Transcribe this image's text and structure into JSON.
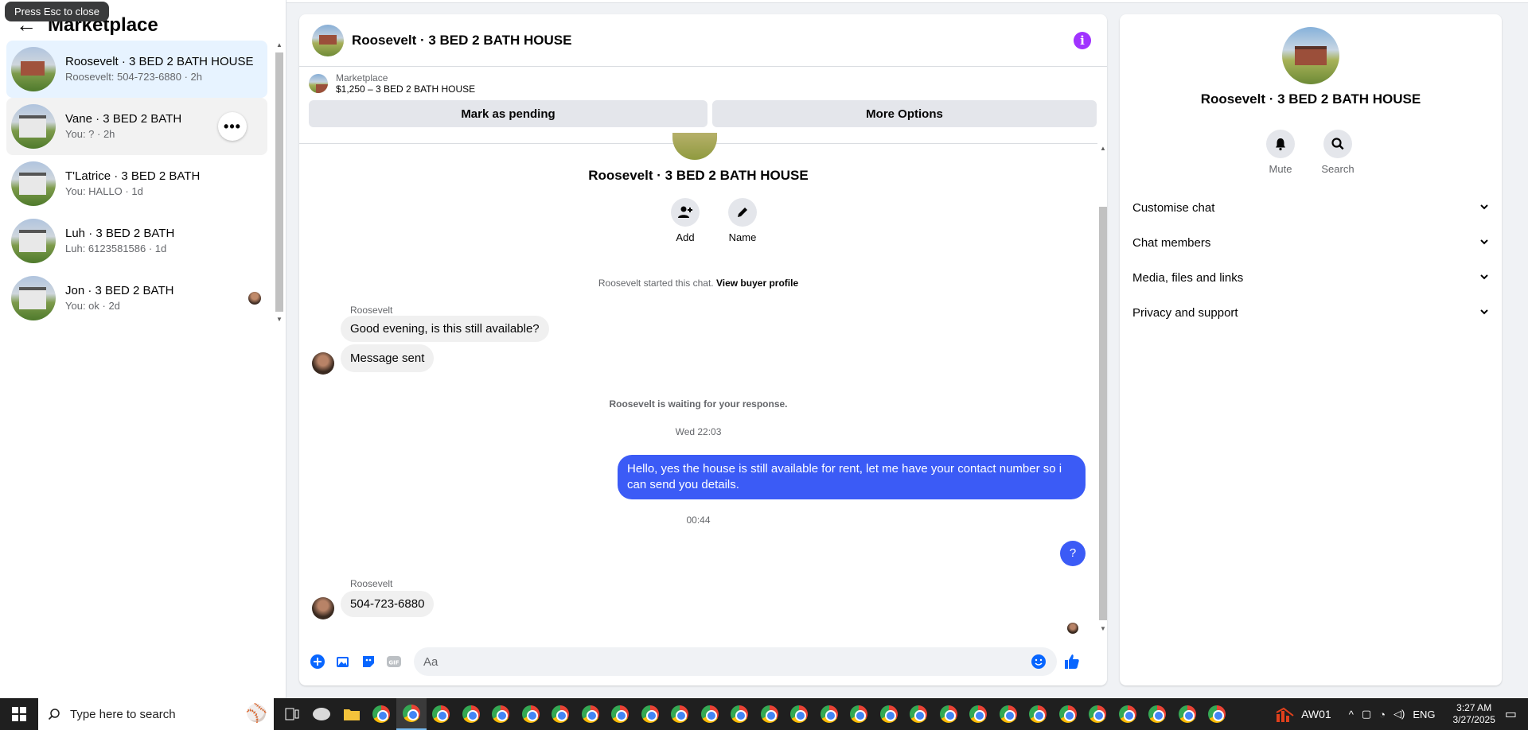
{
  "tooltip": "Press Esc to close",
  "left_panel": {
    "title": "Marketplace",
    "conversations": [
      {
        "title": "Roosevelt · 3 BED 2 BATH HOUSE",
        "subtitle": "Roosevelt: 504-723-6880 · 2h",
        "state": "selected"
      },
      {
        "title": "Vane · 3 BED 2 BATH",
        "subtitle": "You: ? · 2h",
        "state": "hover"
      },
      {
        "title": "T'Latrice · 3 BED 2 BATH",
        "subtitle": "You: HALLO · 1d",
        "state": ""
      },
      {
        "title": "Luh · 3 BED 2 BATH",
        "subtitle": "Luh: 6123581586 · 1d",
        "state": ""
      },
      {
        "title": "Jon · 3 BED 2 BATH",
        "subtitle": "You: ok · 2d",
        "state": ""
      }
    ],
    "more_label": "•••"
  },
  "chat": {
    "header_name": "Roosevelt · 3 BED 2 BATH HOUSE",
    "info_icon": "i",
    "listing_label": "Marketplace",
    "listing_price": "$1,250 – 3 BED 2 BATH HOUSE",
    "mark_pending": "Mark as pending",
    "more_options": "More Options",
    "conv_name": "Roosevelt · 3 BED 2 BATH HOUSE",
    "add_label": "Add",
    "name_label": "Name",
    "started_text": "Roosevelt started this chat.",
    "view_profile": "View buyer profile",
    "sender1": "Roosevelt",
    "msg1": "Good evening, is this still available?",
    "msg2": "Message sent",
    "waiting": "Roosevelt is waiting for your response.",
    "time1": "Wed 22:03",
    "msg3": "Hello, yes the house is still available for rent, let me have your contact number so i can send you details.",
    "time2": "00:44",
    "msg4": "?",
    "sender2": "Roosevelt",
    "msg5": "504-723-6880",
    "composer_placeholder": "Aa"
  },
  "right_panel": {
    "name": "Roosevelt · 3 BED 2 BATH HOUSE",
    "mute": "Mute",
    "search": "Search",
    "sections": [
      "Customise chat",
      "Chat members",
      "Media, files and links",
      "Privacy and support"
    ]
  },
  "taskbar": {
    "search_placeholder": "Type here to search",
    "app_label": "AW01",
    "lang": "ENG",
    "time": "3:27 AM",
    "date": "3/27/2025"
  },
  "colors": {
    "accent_blue": "#0866ff",
    "outgoing_bubble": "#3b5bf6",
    "info_purple": "#a033ff",
    "selected_row": "#e7f3ff"
  }
}
